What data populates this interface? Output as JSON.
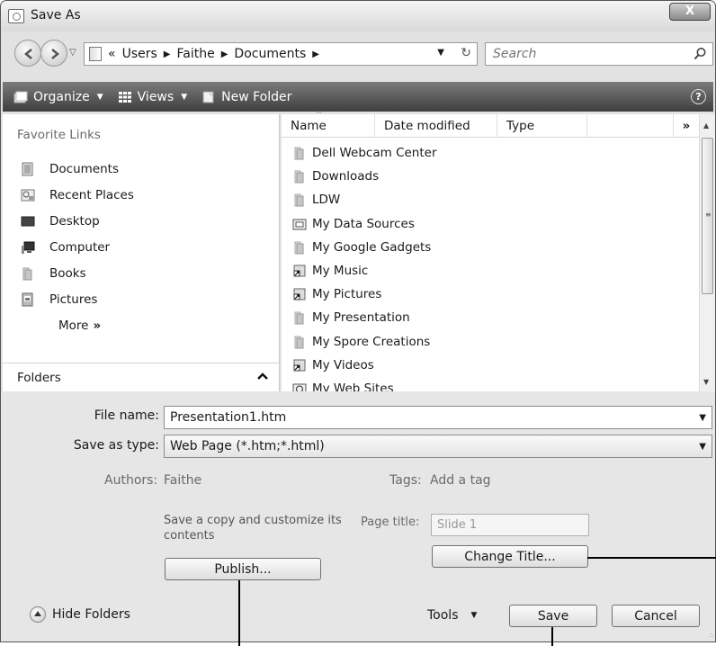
{
  "window": {
    "title": "Save As",
    "close_glyph": "X"
  },
  "address": {
    "recent_glyph": "▽",
    "crumb_lead": "«",
    "crumbs": [
      "Users",
      "Faithe",
      "Documents"
    ],
    "crumb_sep": "▶",
    "dropdown_glyph": "▼",
    "refresh_glyph": "↻",
    "search_placeholder": "Search"
  },
  "toolbar": {
    "organize_label": "Organize",
    "views_label": "Views",
    "new_folder_label": "New Folder",
    "caret": "▼",
    "help_glyph": "?"
  },
  "favorites": {
    "header": "Favorite Links",
    "items": [
      {
        "label": "Documents",
        "icon": "documents-icon"
      },
      {
        "label": "Recent Places",
        "icon": "recent-places-icon"
      },
      {
        "label": "Desktop",
        "icon": "desktop-icon"
      },
      {
        "label": "Computer",
        "icon": "computer-icon"
      },
      {
        "label": "Books",
        "icon": "folder-icon"
      },
      {
        "label": "Pictures",
        "icon": "pictures-icon"
      }
    ],
    "more_label": "More",
    "more_glyph": "»",
    "folders_label": "Folders",
    "folders_glyph": "^"
  },
  "file_list": {
    "columns": {
      "name": "Name",
      "date": "Date modified",
      "type": "Type",
      "more": "»"
    },
    "sort_glyph": "^",
    "items": [
      {
        "label": "Dell Webcam Center",
        "icon": "folder-icon"
      },
      {
        "label": "Downloads",
        "icon": "folder-icon"
      },
      {
        "label": "LDW",
        "icon": "folder-icon"
      },
      {
        "label": "My Data Sources",
        "icon": "data-sources-icon"
      },
      {
        "label": "My Google Gadgets",
        "icon": "folder-icon"
      },
      {
        "label": "My Music",
        "icon": "shortcut-icon"
      },
      {
        "label": "My Pictures",
        "icon": "shortcut-icon"
      },
      {
        "label": "My Presentation",
        "icon": "folder-icon"
      },
      {
        "label": "My Spore Creations",
        "icon": "folder-icon"
      },
      {
        "label": "My Videos",
        "icon": "shortcut-icon"
      },
      {
        "label": "My Web Sites",
        "icon": "web-folder-icon"
      }
    ],
    "scroll_up": "▲",
    "scroll_down": "▼",
    "scroll_grip": "≡"
  },
  "form": {
    "file_name_label": "File name:",
    "file_name_value": "Presentation1.htm",
    "save_type_label": "Save as type:",
    "save_type_value": "Web Page (*.htm;*.html)",
    "dropdown_glyph": "▼",
    "authors_label": "Authors:",
    "authors_value": "Faithe",
    "tags_label": "Tags:",
    "tags_value": "Add a tag",
    "save_copy_text": "Save a copy and customize its contents",
    "page_title_label": "Page title:",
    "page_title_value": "Slide 1",
    "publish_label": "Publish...",
    "change_title_label": "Change Title...",
    "hide_folders_label": "Hide Folders",
    "tools_label": "Tools",
    "tools_caret": "▼",
    "save_label": "Save",
    "cancel_label": "Cancel",
    "grip": "∴"
  }
}
